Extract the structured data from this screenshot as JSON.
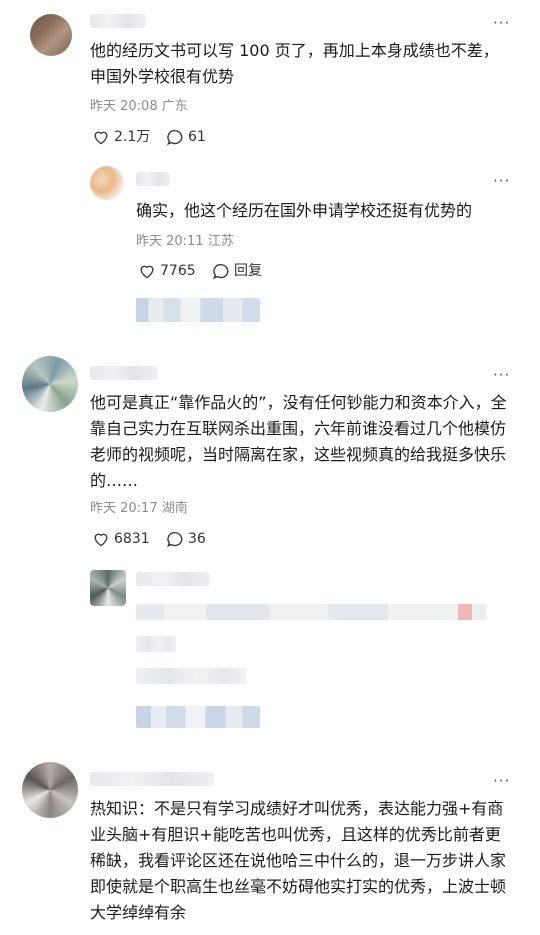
{
  "comments": [
    {
      "text": "他的经历文书可以写 100 页了，再加上本身成绩也不差，申国外学校很有优势",
      "time": "昨天 20:08",
      "location": "广东",
      "likes": "2.1万",
      "replies": "61"
    },
    {
      "text": "确实，他这个经历在国外申请学校还挺有优势的",
      "time": "昨天 20:11",
      "location": "江苏",
      "likes": "7765",
      "reply_label": "回复"
    },
    {
      "text": "他可是真正“靠作品火的”，没有任何钞能力和资本介入，全靠自己实力在互联网杀出重围，六年前谁没看过几个他模仿老师的视频呢，当时隔离在家，这些视频真的给我挺多快乐的……",
      "time": "昨天 20:17",
      "location": "湖南",
      "likes": "6831",
      "replies": "36"
    },
    {
      "text": "热知识：不是只有学习成绩好才叫优秀，表达能力强+有商业头脑+有胆识+能吃苦也叫优秀，且这样的优秀比前者更稀缺，我看评论区还在说他哈三中什么的，退一万步讲人家即使就是个职高生也丝毫不妨碍他实打实的优秀，上波士顿大学绰绰有余"
    }
  ],
  "more_label": "···",
  "icons": {
    "like": "heart-outline-icon",
    "comment": "speech-bubble-icon",
    "more": "more-dots-icon"
  }
}
